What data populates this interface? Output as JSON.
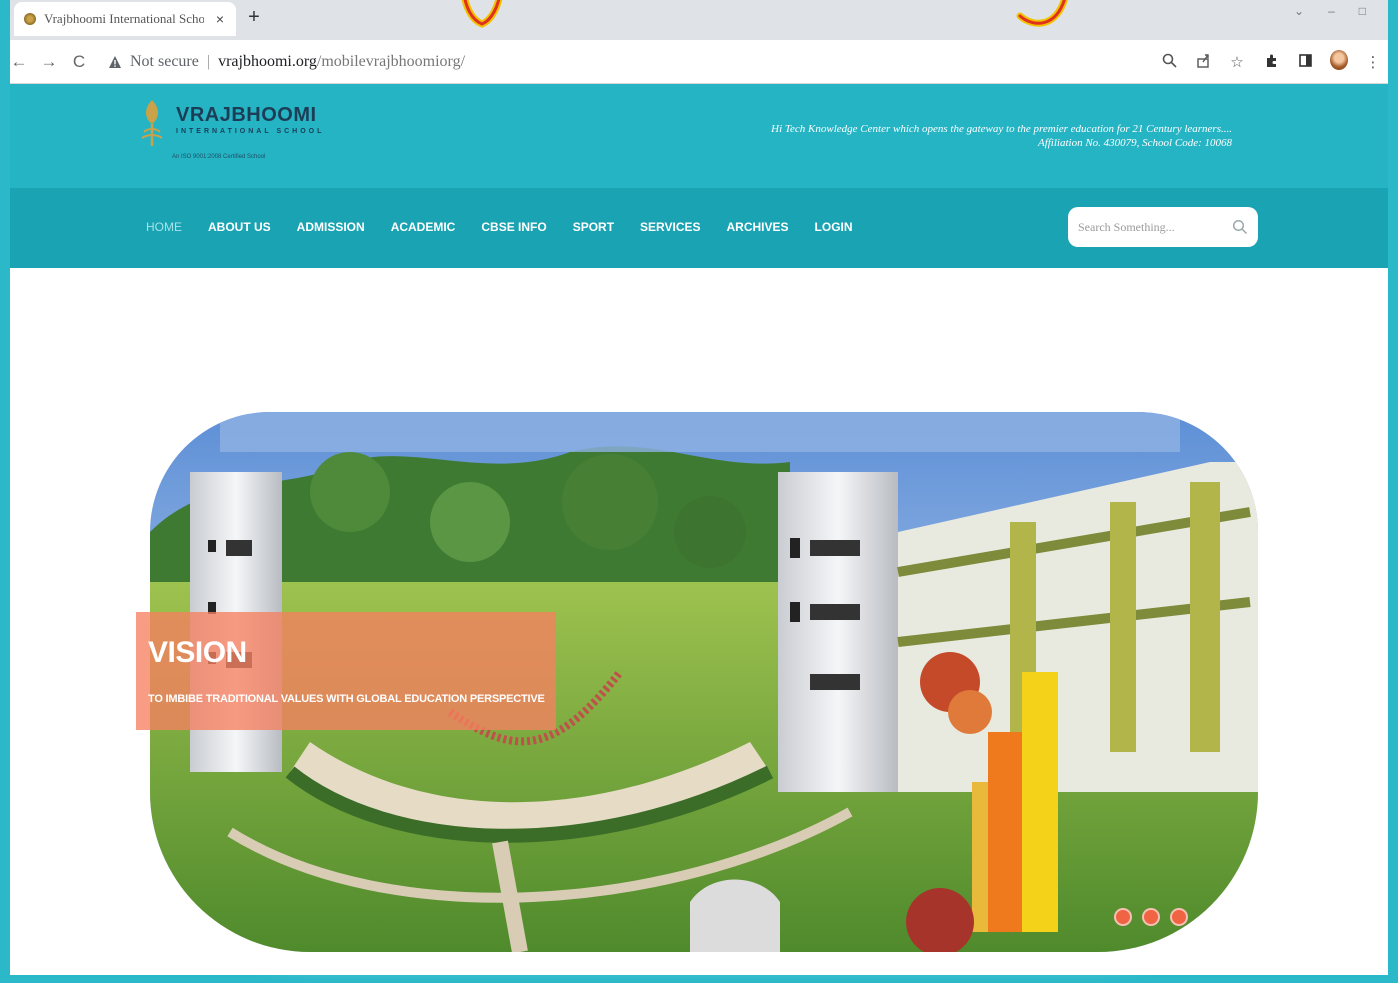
{
  "browser": {
    "tab_title": "Vrajbhoomi International School",
    "tab_close": "×",
    "new_tab": "+",
    "nav_back": "←",
    "nav_forward": "→",
    "nav_reload": "C",
    "not_secure": "Not secure",
    "separator": "|",
    "url_host": "vrajbhoomi.org",
    "url_path": "/mobilevrajbhoomiorg/",
    "icons": [
      "zoom-icon",
      "share-icon",
      "star-icon",
      "extensions-icon",
      "sidepanel-icon",
      "profile-avatar",
      "menu-icon"
    ]
  },
  "header": {
    "logo_name": "VRAJBHOOMI",
    "logo_sub": "INTERNATIONAL SCHOOL",
    "logo_iso": "An ISO 9001:2008 Certified School",
    "tagline_line1": "Hi Tech Knowledge Center which opens the gateway to the premier education for 21 Century learners....",
    "tagline_line2": "Affiliation No. 430079, School Code: 10068"
  },
  "nav": {
    "items": [
      {
        "label": "HOME",
        "active": true
      },
      {
        "label": "ABOUT US",
        "active": false
      },
      {
        "label": "ADMISSION",
        "active": false
      },
      {
        "label": "ACADEMIC",
        "active": false
      },
      {
        "label": "CBSE INFO",
        "active": false
      },
      {
        "label": "SPORT",
        "active": false
      },
      {
        "label": "SERVICES",
        "active": false
      },
      {
        "label": "ARCHIVES",
        "active": false
      },
      {
        "label": "LOGIN",
        "active": false
      }
    ],
    "search_placeholder": "Search Something..."
  },
  "hero": {
    "slide_title": "VISION",
    "slide_text": "TO IMBIBE TRADITIONAL VALUES WITH GLOBAL EDUCATION PERSPECTIVE",
    "slide_count": 3
  },
  "colors": {
    "header_bg": "#25b4c4",
    "nav_bg": "#1aa3b2",
    "overlay": "#f68060",
    "dot": "#f06443"
  }
}
